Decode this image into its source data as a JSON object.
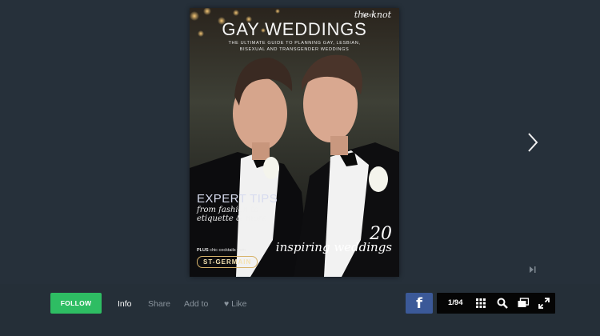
{
  "cover": {
    "brand_from": "from",
    "brand_name": "the knot",
    "title": "GAY WEDDINGS",
    "subtitle_line1": "THE ULTIMATE GUIDE TO PLANNING GAY, LESBIAN,",
    "subtitle_line2": "BISEXUAL AND TRANSGENDER WEDDINGS",
    "expert_tips": "EXPERT TIPS",
    "expert_sub": "from fashion to etiquette & more",
    "plus_label": "PLUS",
    "plus_text": "chic cocktails from",
    "sponsor": "ST-GERMAIN",
    "count": "20",
    "count_sub": "inspiring weddings"
  },
  "bottom_bar": {
    "follow_label": "FOLLOW",
    "links": [
      "Info",
      "Share",
      "Add to",
      "Like"
    ],
    "active_link": "Info",
    "facebook_glyph": "f",
    "page_counter": "1/94"
  },
  "icons": {
    "next": "chevron-right-icon",
    "skip": "skip-to-end-icon",
    "facebook": "facebook-icon",
    "grid": "grid-icon",
    "search": "search-icon",
    "pages": "multi-page-icon",
    "fullscreen": "fullscreen-icon",
    "like": "heart-icon"
  },
  "colors": {
    "background": "#252f38",
    "follow_button": "#2ebd63",
    "facebook": "#3b5998",
    "controls_bg": "#050505"
  }
}
